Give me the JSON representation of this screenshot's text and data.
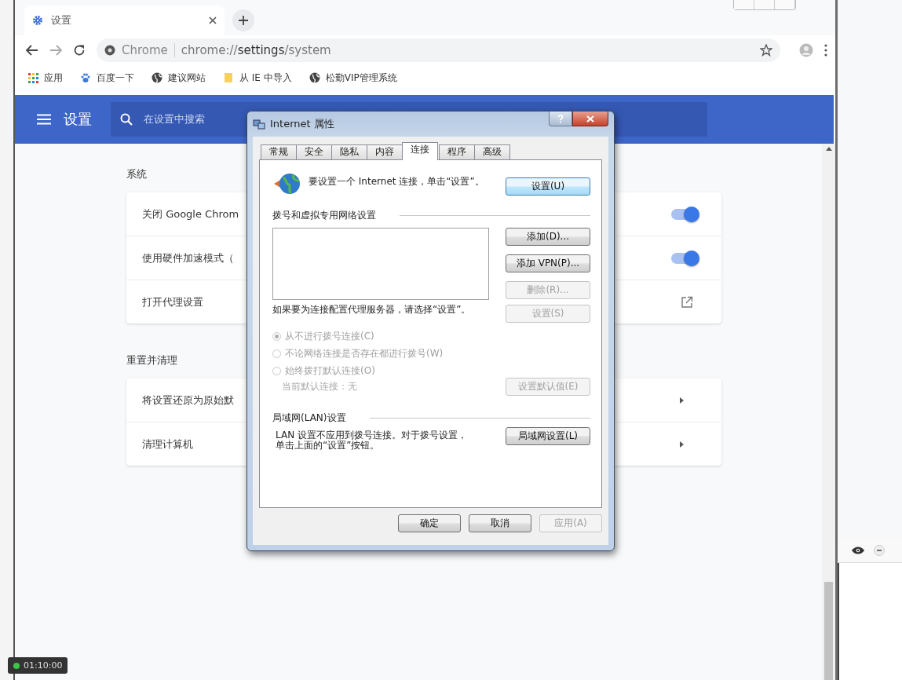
{
  "browser": {
    "tab": {
      "title": "设置"
    },
    "omnibox": {
      "chip": "Chrome",
      "url": "chrome://**settings**/system"
    },
    "bookmarks": [
      {
        "label": "应用",
        "kind": "apps"
      },
      {
        "label": "百度一下",
        "kind": "paw"
      },
      {
        "label": "建议网站",
        "kind": "globe"
      },
      {
        "label": "从 IE 中导入",
        "kind": "folder"
      },
      {
        "label": "松勤VIP管理系统",
        "kind": "globe"
      }
    ]
  },
  "settings_header": {
    "title": "设置",
    "search": {
      "placeholder": "在设置中搜索"
    }
  },
  "sections": [
    {
      "title": "系统",
      "rows": [
        {
          "label": "关闭 Google Chrom",
          "kind": "toggle",
          "on": true
        },
        {
          "label": "使用硬件加速模式（",
          "kind": "toggle",
          "on": true
        },
        {
          "label": "打开代理设置",
          "kind": "external"
        }
      ]
    },
    {
      "title": "重置并清理",
      "rows": [
        {
          "label": "将设置还原为原始默",
          "kind": "arrow"
        },
        {
          "label": "清理计算机",
          "kind": "arrow"
        }
      ]
    }
  ],
  "dialog": {
    "title": "Internet 属性",
    "tabs": [
      {
        "label": "常规",
        "selected": false
      },
      {
        "label": "安全",
        "selected": false
      },
      {
        "label": "隐私",
        "selected": false
      },
      {
        "label": "内容",
        "selected": false
      },
      {
        "label": "连接",
        "selected": true
      },
      {
        "label": "程序",
        "selected": false
      },
      {
        "label": "高级",
        "selected": false
      }
    ],
    "setup_text": "要设置一个 Internet 连接，单击“设置”。",
    "setup_button": {
      "label": "设置(U)",
      "disabled": false
    },
    "dialup_group": "拨号和虚拟专用网络设置",
    "dialup_buttons": [
      {
        "label": "添加(D)...",
        "disabled": false
      },
      {
        "label": "添加 VPN(P)...",
        "disabled": false
      },
      {
        "label": "删除(R)...",
        "disabled": true
      }
    ],
    "proxy_text": "如果要为连接配置代理服务器，请选择“设置”。",
    "proxy_button": {
      "label": "设置(S)",
      "disabled": true
    },
    "radios": [
      {
        "label": "从不进行拨号连接(C)",
        "selected": true,
        "disabled": true
      },
      {
        "label": "不论网络连接是否存在都进行拨号(W)",
        "selected": false,
        "disabled": true
      },
      {
        "label": "始终拨打默认连接(O)",
        "selected": false,
        "disabled": true
      }
    ],
    "default_connection": {
      "text": "当前默认连接：无",
      "disabled": true
    },
    "default_button": {
      "label": "设置默认值(E)",
      "disabled": true
    },
    "lan_group": "局域网(LAN)设置",
    "lan_text": "LAN 设置不应用到拨号连接。对于拨号设置，单击上面的“设置”按钮。",
    "lan_button": {
      "label": "局域网设置(L)",
      "disabled": false
    },
    "footer_buttons": [
      {
        "label": "确定",
        "disabled": false
      },
      {
        "label": "取消",
        "disabled": false
      },
      {
        "label": "应用(A)",
        "disabled": true
      }
    ]
  },
  "recording_timer": "01:10:00"
}
